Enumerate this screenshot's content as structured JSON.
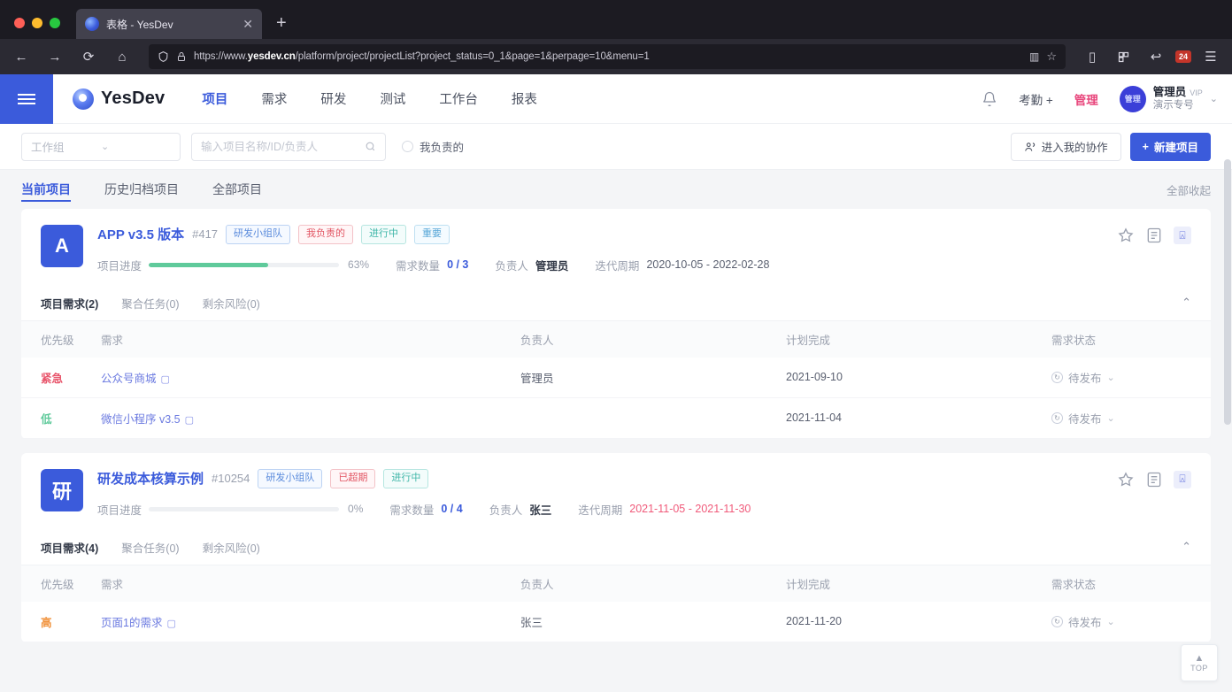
{
  "browser": {
    "tab_title": "表格 - YesDev",
    "tab_close": "✕",
    "new_tab": "+",
    "back": "←",
    "forward": "→",
    "reload": "⟳",
    "home": "⌂",
    "url_prefix": "https://www.",
    "url_domain": "yesdev.cn",
    "url_suffix": "/platform/project/projectList?project_status=0_1&page=1&perpage=10&menu=1",
    "shield_icon": "shield-icon",
    "lock_icon": "lock-icon",
    "bookmark_icon": "☆",
    "reader_icon": "▥",
    "extension_badge": "24",
    "sidebar_icon": "▯",
    "undo_icon": "↩",
    "menu_icon": "☰"
  },
  "header": {
    "menu_toggle": "menu-toggle",
    "brand": "YesDev",
    "nav": [
      {
        "label": "项目",
        "active": true
      },
      {
        "label": "需求",
        "active": false
      },
      {
        "label": "研发",
        "active": false
      },
      {
        "label": "测试",
        "active": false
      },
      {
        "label": "工作台",
        "active": false
      },
      {
        "label": "报表",
        "active": false
      }
    ],
    "notification_icon": "bell-icon",
    "add_link": "考勤 +",
    "manage_link": "管理",
    "user": {
      "avatar_text": "管理",
      "name": "管理员",
      "name_tag": "VIP",
      "sub": "演示专号",
      "caret": "⌄"
    }
  },
  "toolbar": {
    "group_select": "工作组",
    "select_caret": "⌄",
    "search_placeholder": "输入项目名称/ID/负责人",
    "search_value": "",
    "search_icon": "🔍",
    "checkbox_label": "我负责的",
    "enter_collab": "进入我的协作",
    "enter_collab_icon": "users-icon",
    "new_project": "新建项目",
    "new_project_icon": "+"
  },
  "tabs": {
    "items": [
      {
        "label": "当前项目",
        "active": true
      },
      {
        "label": "历史归档项目",
        "active": false
      },
      {
        "label": "全部项目",
        "active": false
      }
    ],
    "right_action": "全部收起"
  },
  "table_headers": {
    "priority": "优先级",
    "requirement": "需求",
    "owner": "负责人",
    "planned": "计划完成",
    "status": "需求状态"
  },
  "projects": [
    {
      "icon_letter": "A",
      "title": "APP v3.5 版本",
      "id": "#417",
      "tags": [
        {
          "text": "研发小组队",
          "color": "blue"
        },
        {
          "text": "我负责的",
          "color": "red"
        },
        {
          "text": "进行中",
          "color": "teal"
        },
        {
          "text": "重要",
          "color": "cyan"
        }
      ],
      "progress_label": "项目进度",
      "progress_pct": 63,
      "progress_text": "63%",
      "req_label": "需求数量",
      "req_value": "0 / 3",
      "owner_label": "负责人",
      "owner_value": "管理员",
      "cycle_label": "迭代周期",
      "cycle_value": "2020-10-05 - 2022-02-28",
      "cycle_overdue": false,
      "subtabs": [
        {
          "label": "项目需求(2)",
          "active": true
        },
        {
          "label": "聚合任务(0)",
          "active": false
        },
        {
          "label": "剩余风险(0)",
          "active": false
        }
      ],
      "collapse_icon": "⌃",
      "rows": [
        {
          "priority": "紧急",
          "priority_class": "urgent",
          "name": "公众号商城",
          "owner": "管理员",
          "planned": "2021-09-10",
          "status": "待发布"
        },
        {
          "priority": "低",
          "priority_class": "low",
          "name": "微信小程序 v3.5",
          "owner": "",
          "planned": "2021-11-04",
          "status": "待发布"
        }
      ]
    },
    {
      "icon_letter": "研",
      "title": "研发成本核算示例",
      "id": "#10254",
      "tags": [
        {
          "text": "研发小组队",
          "color": "blue"
        },
        {
          "text": "已超期",
          "color": "red"
        },
        {
          "text": "进行中",
          "color": "teal"
        }
      ],
      "progress_label": "项目进度",
      "progress_pct": 0,
      "progress_text": "0%",
      "req_label": "需求数量",
      "req_value": "0 / 4",
      "owner_label": "负责人",
      "owner_value": "张三",
      "cycle_label": "迭代周期",
      "cycle_value": "2021-11-05 - 2021-11-30",
      "cycle_overdue": true,
      "subtabs": [
        {
          "label": "项目需求(4)",
          "active": true
        },
        {
          "label": "聚合任务(0)",
          "active": false
        },
        {
          "label": "剩余风险(0)",
          "active": false
        }
      ],
      "collapse_icon": "⌃",
      "rows": [
        {
          "priority": "高",
          "priority_class": "high",
          "name": "页面1的需求",
          "owner": "张三",
          "planned": "2021-11-20",
          "status": "待发布"
        }
      ]
    }
  ],
  "top_button": {
    "arrow": "▲",
    "label": "TOP"
  }
}
